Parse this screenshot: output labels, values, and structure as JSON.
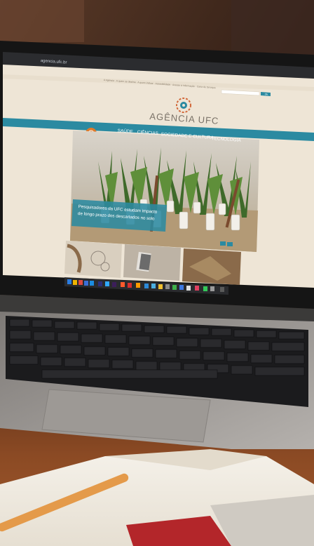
{
  "browser": {
    "url": "agencia.ufc.br"
  },
  "site": {
    "top_links": "A Agência · A quem se destina · A quem indicar · Acessibilidade · Acesso à Informação · Carta de Serviços",
    "search_button": "Ok",
    "logo_text": "AGÊNCIA UFC",
    "menu": [
      "SAÚDE",
      "CIÊNCIAS",
      "SOCIEDADE E CULTURA",
      "TECNOLOGIA"
    ],
    "headline": "Pesquisadores da UFC estudam impacto de longo prazo dos descartados no solo"
  },
  "colors": {
    "teal_bar": "#2b8aa1",
    "screen_bg": "#eee5d6",
    "logo_accent": "#d2683a",
    "table_wood": "#6b3a1f"
  }
}
